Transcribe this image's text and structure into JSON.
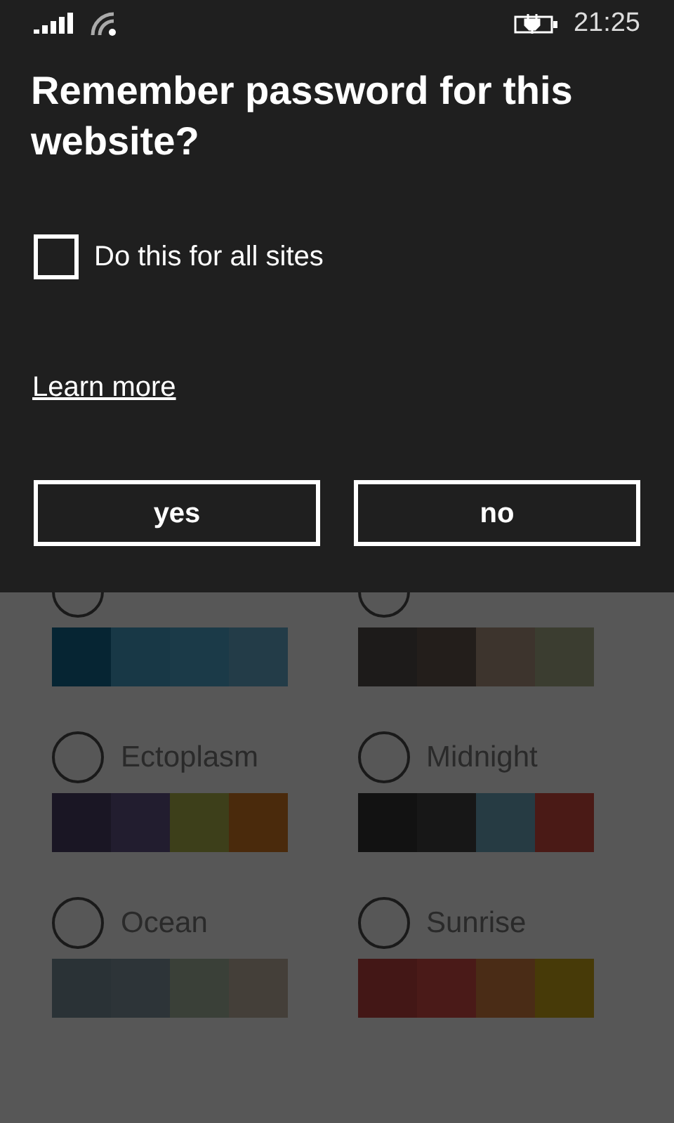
{
  "status_bar": {
    "time": "21:25"
  },
  "dialog": {
    "title": "Remember password for this website?",
    "checkbox": {
      "label": "Do this for all sites",
      "checked": false
    },
    "link": "Learn more",
    "buttons": [
      "yes",
      "no"
    ]
  },
  "themes": [
    {
      "selected": false,
      "swatches": [
        {
          "color": "#062533"
        },
        {
          "color": "#183846"
        },
        {
          "color": "#1b3a48"
        },
        {
          "color": "#233c48"
        }
      ]
    },
    {
      "selected": false,
      "swatches": [
        {
          "color": "#1d1b1a"
        },
        {
          "color": "#231e1b"
        },
        {
          "color": "#3d342d"
        },
        {
          "color": "#3b3d30"
        }
      ]
    },
    {
      "name": "Ectoplasm",
      "selected": false,
      "swatches": [
        {
          "color": "#1a1624"
        },
        {
          "color": "#221d2f"
        },
        {
          "color": "#3d3f1a"
        },
        {
          "color": "#4a2a0c"
        }
      ]
    },
    {
      "name": "Midnight",
      "selected": false,
      "swatches": [
        {
          "color": "#121212"
        },
        {
          "color": "#171717"
        },
        {
          "color": "#263b43"
        },
        {
          "color": "#4a1a16"
        }
      ]
    },
    {
      "name": "Ocean",
      "selected": false,
      "swatches": [
        {
          "color": "#2a3236"
        },
        {
          "color": "#2d3438"
        },
        {
          "color": "#3a4038"
        },
        {
          "color": "#443f39"
        }
      ]
    },
    {
      "name": "Sunrise",
      "selected": false,
      "swatches": [
        {
          "color": "#431716"
        },
        {
          "color": "#4a1a18"
        },
        {
          "color": "#4a2c16"
        },
        {
          "color": "#473a08"
        }
      ]
    }
  ]
}
